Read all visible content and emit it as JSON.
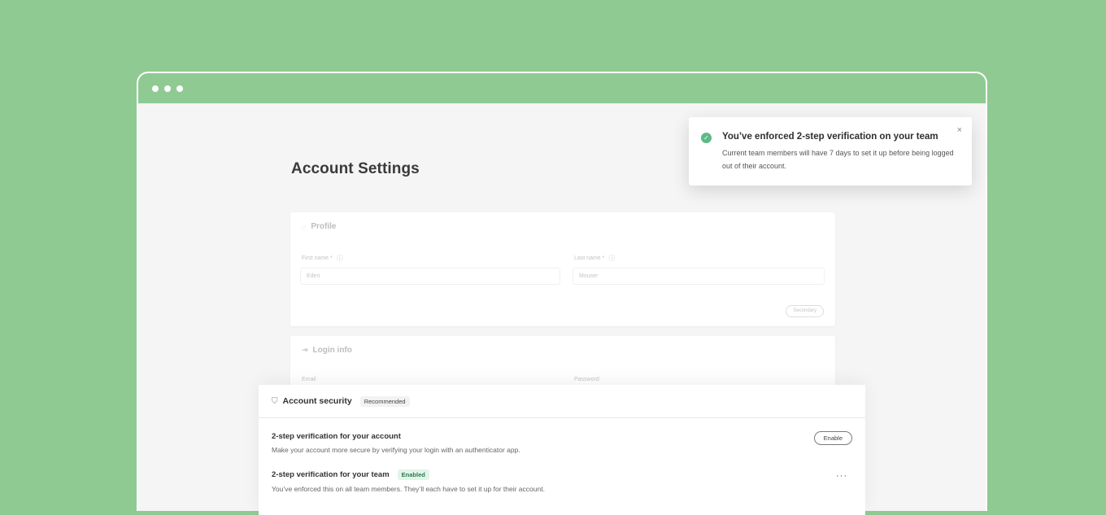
{
  "page": {
    "title": "Account Settings"
  },
  "toast": {
    "title": "You’ve enforced 2-step verification on your team",
    "body": "Current team members will have 7 days to set it up before being logged out of their account.",
    "close": "×",
    "check": "✓"
  },
  "profile": {
    "title": "Profile",
    "first_name_label": "First name *",
    "first_name_value": "Eden",
    "last_name_label": "Last name *",
    "last_name_value": "Mouser",
    "secondary_label": "Secondary"
  },
  "login": {
    "title": "Login info",
    "email_label": "Email",
    "password_label": "Password"
  },
  "security": {
    "title": "Account security",
    "badge": "Recommended",
    "rows": [
      {
        "title": "2-step verification for your account",
        "description": "Make your account more secure by verifying your login with an authenticator app.",
        "action": "Enable"
      },
      {
        "title": "2-step verification for your team",
        "badge": "Enabled",
        "description": "You’ve enforced this on all team members. They’ll each have to set it up for their account.",
        "action": "···"
      }
    ]
  },
  "colors": {
    "background": "#8fca93",
    "success": "#5dba86",
    "enabled_bg": "#e3f4ea"
  }
}
